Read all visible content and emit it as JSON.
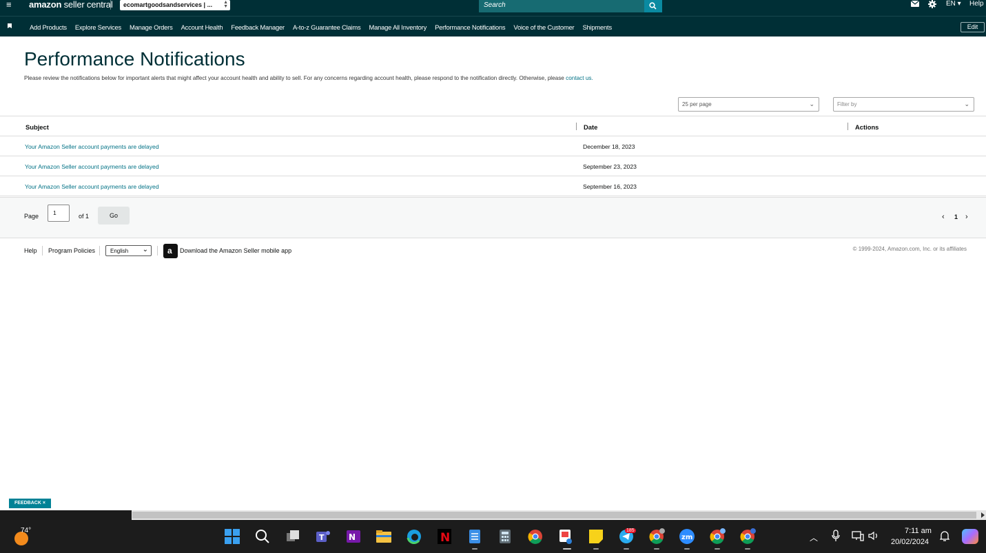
{
  "header": {
    "logo_text_bold": "amazon",
    "logo_text": " seller central",
    "account_selector": "ecomartgoodsandservices | ...",
    "search_placeholder": "Search",
    "language": "EN",
    "help": "Help"
  },
  "nav": {
    "items": [
      "Add Products",
      "Explore Services",
      "Manage Orders",
      "Account Health",
      "Feedback Manager",
      "A-to-z Guarantee Claims",
      "Manage All Inventory",
      "Performance Notifications",
      "Voice of the Customer",
      "Shipments"
    ],
    "edit": "Edit"
  },
  "page": {
    "title": "Performance Notifications",
    "description": "Please review the notifications below for important alerts that might affect your account health and ability to sell. For any concerns regarding account health, please respond to the notification directly. Otherwise, please ",
    "contact_link": "contact us.",
    "per_page": "25 per page",
    "filter_placeholder": "Filter by"
  },
  "table": {
    "columns": [
      "Subject",
      "Date",
      "Actions"
    ],
    "rows": [
      {
        "subject": "Your Amazon Seller account payments are delayed",
        "date": "December 18, 2023"
      },
      {
        "subject": "Your Amazon Seller account payments are delayed",
        "date": "September 23, 2023"
      },
      {
        "subject": "Your Amazon Seller account payments are delayed",
        "date": "September 16, 2023"
      }
    ]
  },
  "pager": {
    "page_label": "Page",
    "page_value": "1",
    "of_label": "of 1",
    "go": "Go",
    "current": "1"
  },
  "footer": {
    "help": "Help",
    "policies": "Program Policies",
    "language": "English",
    "app_download": "Download the Amazon Seller mobile app",
    "copyright": "© 1999-2024, Amazon.com, Inc. or its affiliates"
  },
  "feedback": "FEEDBACK ×",
  "taskbar": {
    "temperature": "74°",
    "telegram_badge": "185",
    "time": "7:11 am",
    "date": "20/02/2024",
    "colors": {
      "accent": "#008296",
      "header_bg": "#002f36",
      "link": "#007185"
    }
  }
}
